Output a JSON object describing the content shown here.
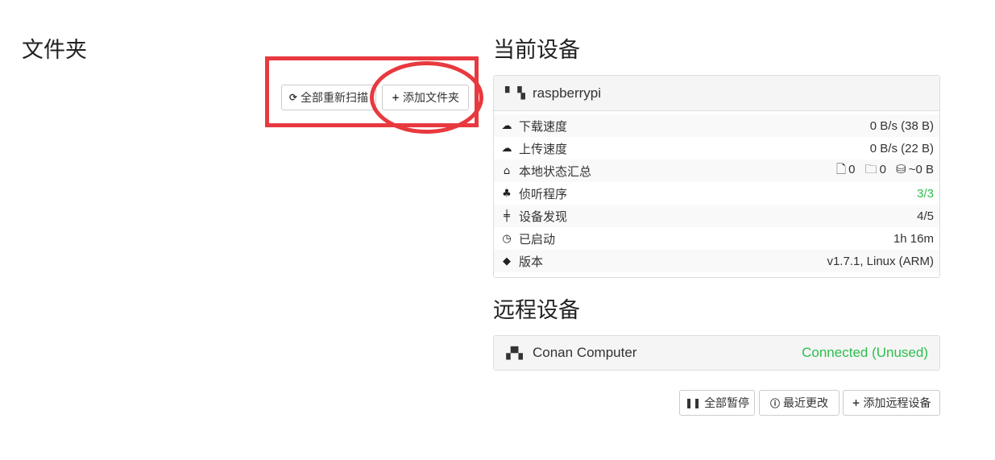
{
  "folders": {
    "title": "文件夹",
    "rescan_all_label": "全部重新扫描",
    "add_folder_label": "添加文件夹"
  },
  "this_device": {
    "title": "当前设备",
    "name": "raspberrypi",
    "stats": [
      {
        "icon": "cloud-download-icon",
        "label": "下载速度",
        "value": "0 B/s (38 B)"
      },
      {
        "icon": "cloud-upload-icon",
        "label": "上传速度",
        "value": "0 B/s (22 B)"
      },
      {
        "icon": "home-icon",
        "label": "本地状态汇总",
        "files": "0",
        "dirs": "0",
        "size": "~0 B"
      },
      {
        "icon": "sitemap-icon",
        "label": "侦听程序",
        "value": "3/3"
      },
      {
        "icon": "signpost-icon",
        "label": "设备发现",
        "value": "4/5"
      },
      {
        "icon": "clock-icon",
        "label": "已启动",
        "value": "1h 16m"
      },
      {
        "icon": "tag-icon",
        "label": "版本",
        "value": "v1.7.1, Linux (ARM)"
      }
    ]
  },
  "remote_devices": {
    "title": "远程设备",
    "devices": [
      {
        "name": "Conan Computer",
        "status": "Connected (Unused)"
      }
    ],
    "pause_all_label": "全部暂停",
    "recent_changes_label": "最近更改",
    "add_remote_label": "添加远程设备"
  },
  "colors": {
    "annotation": "#e8393f",
    "status_green": "#2cbe4e"
  }
}
